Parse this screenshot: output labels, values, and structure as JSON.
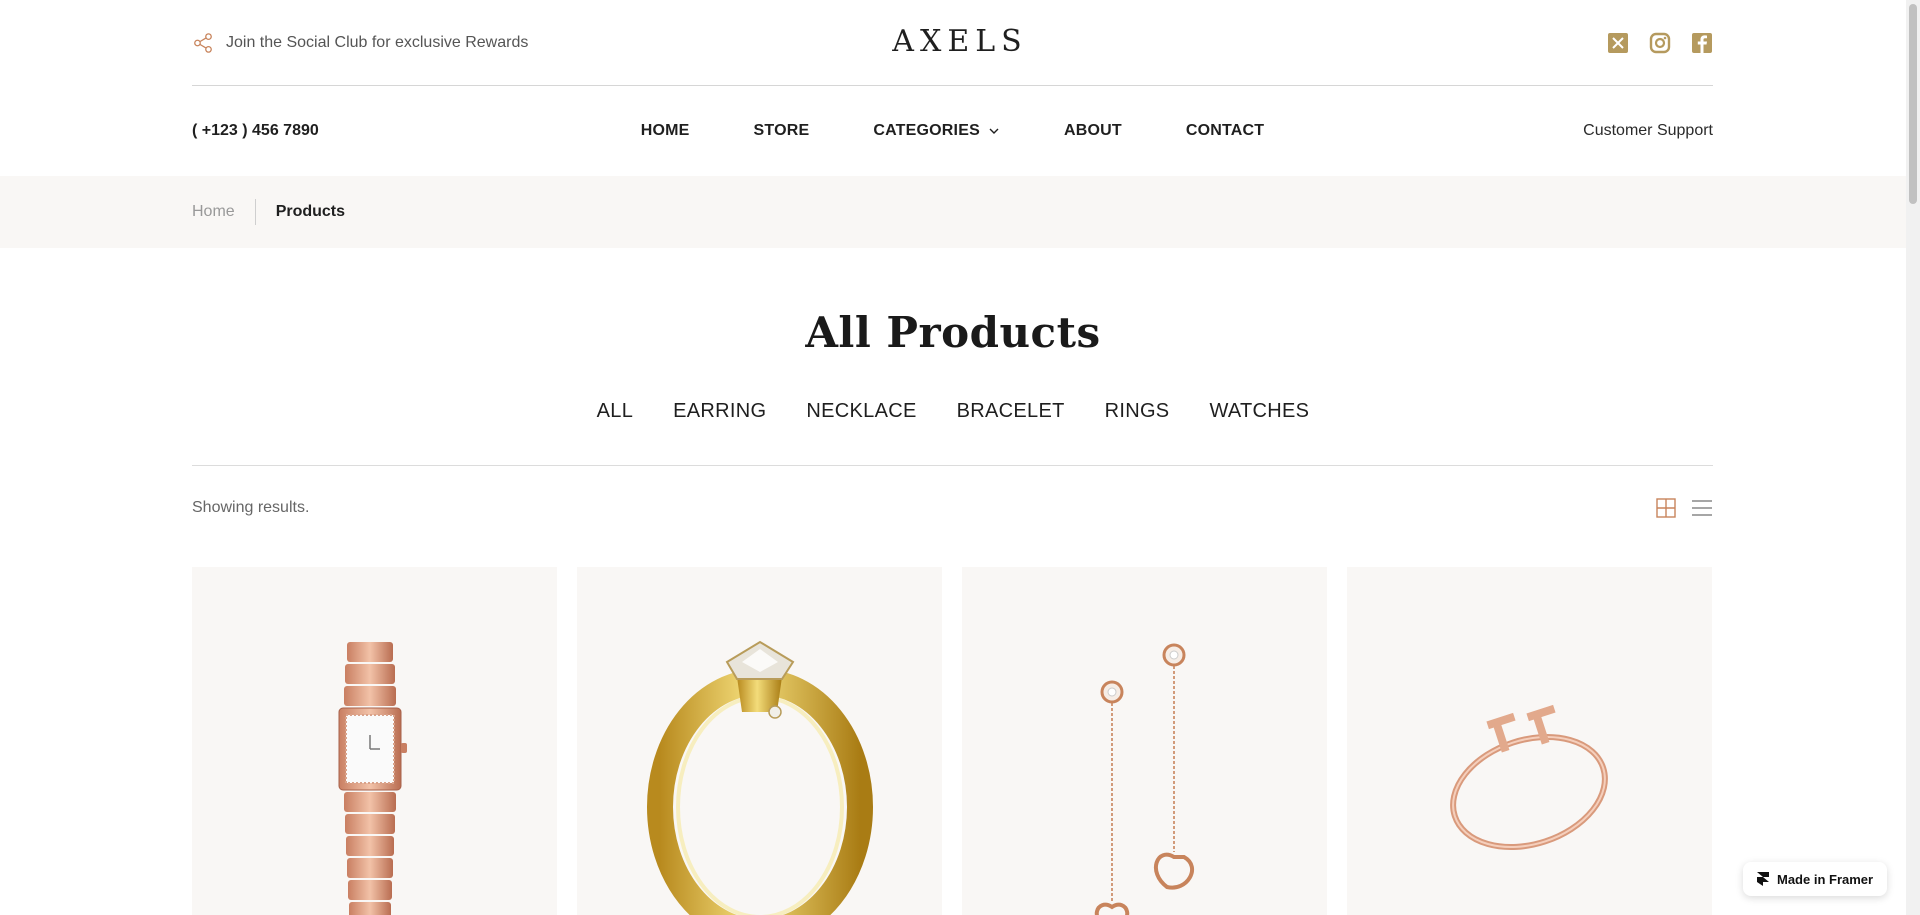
{
  "header": {
    "club_text": "Join the Social Club for exclusive Rewards",
    "logo": "AXELS",
    "socials": [
      "x-icon",
      "instagram-icon",
      "facebook-icon"
    ]
  },
  "nav": {
    "phone": "( +123 ) 456 7890",
    "items": [
      {
        "label": "HOME"
      },
      {
        "label": "STORE"
      },
      {
        "label": "CATEGORIES"
      },
      {
        "label": "ABOUT"
      },
      {
        "label": "CONTACT"
      }
    ],
    "support": "Customer Support"
  },
  "breadcrumb": {
    "home": "Home",
    "current": "Products"
  },
  "page": {
    "title": "All Products",
    "filters": [
      "ALL",
      "EARRING",
      "NECKLACE",
      "BRACELET",
      "RINGS",
      "WATCHES"
    ],
    "results_text": "Showing results."
  },
  "products": [
    {
      "kind": "watch"
    },
    {
      "kind": "ring"
    },
    {
      "kind": "earrings"
    },
    {
      "kind": "bracelet"
    }
  ],
  "badge": {
    "text": "Made in Framer"
  },
  "colors": {
    "accent": "#c8845c",
    "gold": "#b59a5e",
    "strip_bg": "#f9f7f5"
  }
}
